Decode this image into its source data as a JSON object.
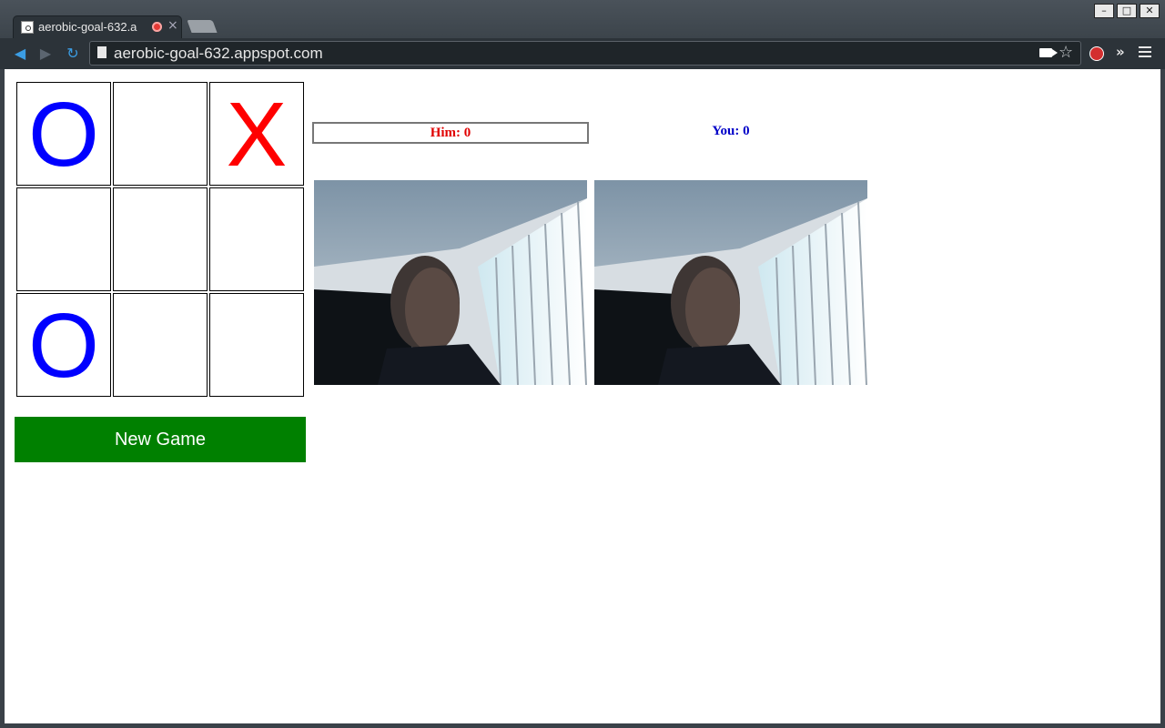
{
  "browser": {
    "tab_title": "aerobic-goal-632.a",
    "url": "aerobic-goal-632.appspot.com"
  },
  "board": {
    "cells": [
      "O",
      "",
      "X",
      "",
      "",
      "",
      "O",
      "",
      ""
    ]
  },
  "colors": {
    "o_mark": "#0000ff",
    "x_mark": "#ff0000",
    "new_game_bg": "#008000",
    "him_score": "#e00000",
    "you_score": "#0000c8"
  },
  "scores": {
    "him": "Him: 0",
    "you": "You: 0"
  },
  "new_game_label": "New Game"
}
